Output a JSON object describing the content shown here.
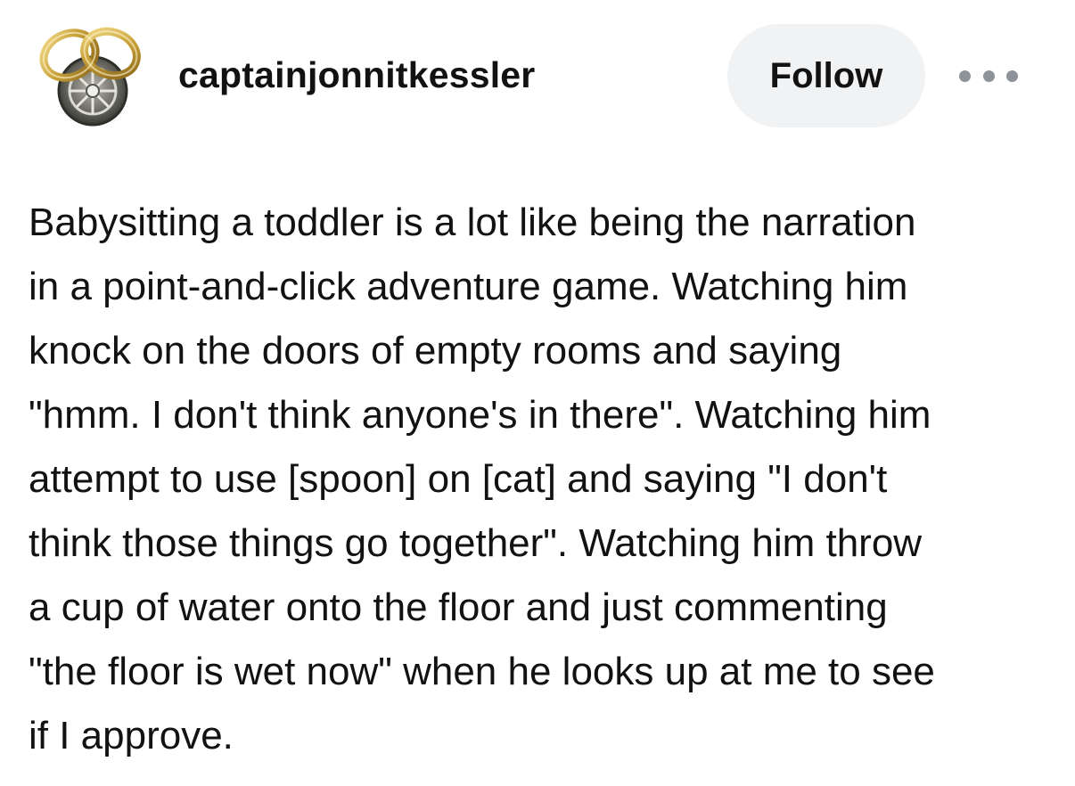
{
  "post": {
    "username": "captainjonnitkessler",
    "follow_label": "Follow",
    "body_lines": [
      "Babysitting a toddler is a lot like being the narration",
      "in a point-and-click adventure game. Watching him",
      "knock on the doors of empty rooms and saying",
      "\"hmm. I don't think anyone's in there\". Watching him",
      "attempt to use [spoon] on [cat] and saying \"I don't",
      "think those things go together\". Watching him throw",
      "a cup of water onto the floor and just commenting",
      "\"the floor is wet now\" when he looks up at me to see",
      "if I approve."
    ]
  },
  "icons": {
    "avatar": "gold-rings-wheel-icon",
    "more": "more-options-icon"
  },
  "colors": {
    "text": "#121212",
    "follow_button_bg": "#f1f2f4",
    "dots": "#8e9299",
    "ring_gold": "#c9a13a"
  }
}
